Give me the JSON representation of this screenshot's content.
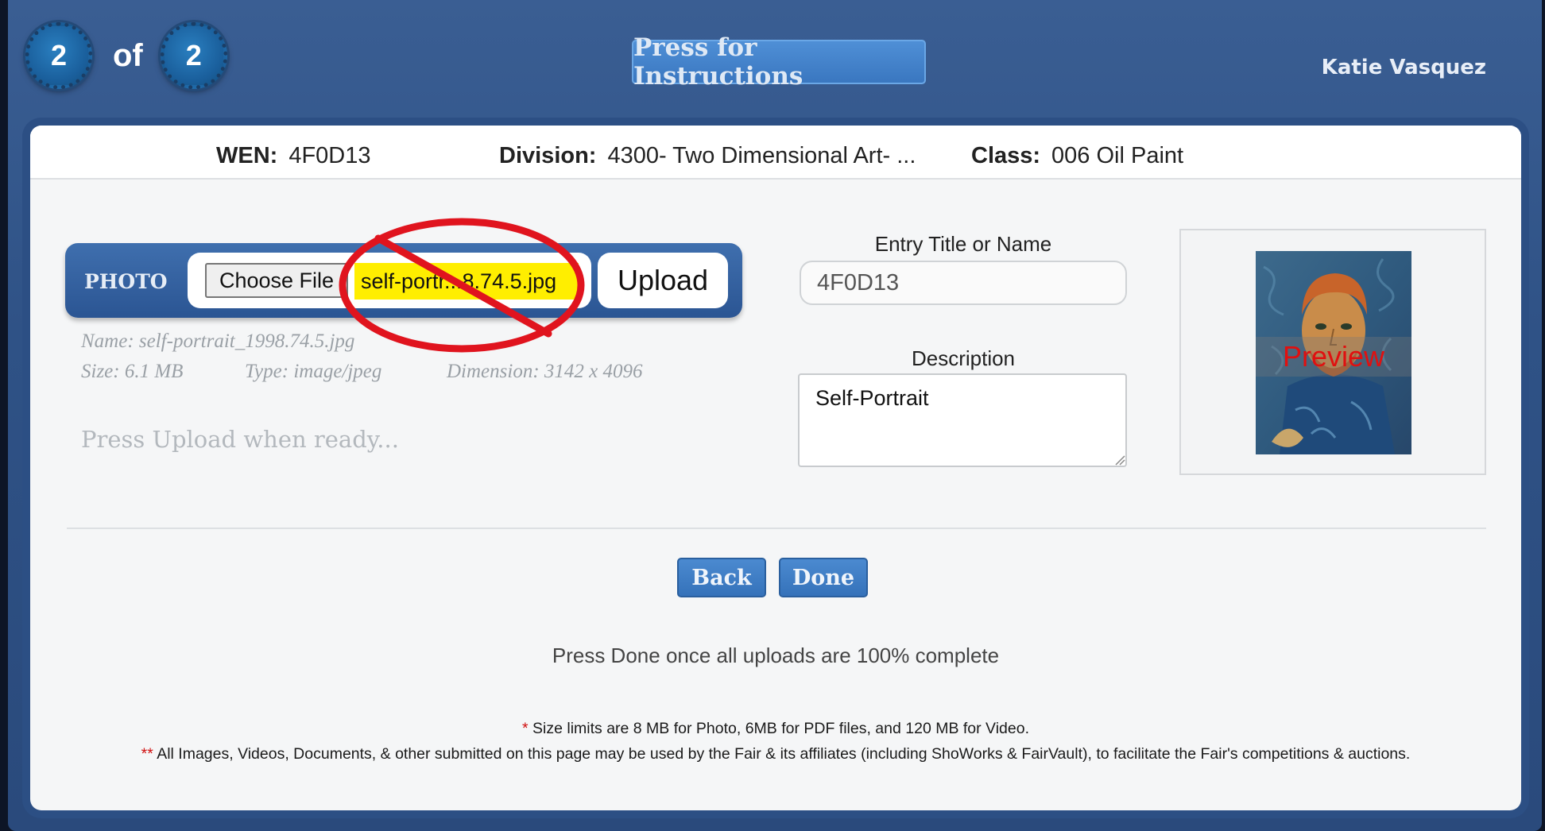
{
  "header": {
    "current_step": "2",
    "of_label": "of",
    "total_steps": "2",
    "instructions_label": "Press for Instructions",
    "user_name": "Katie Vasquez"
  },
  "info_bar": {
    "wen_label": "WEN:",
    "wen_value": "4F0D13",
    "division_label": "Division:",
    "division_value": "4300- Two Dimensional Art- ...",
    "class_label": "Class:",
    "class_value": "006 Oil Paint"
  },
  "upload": {
    "section_label": "PHOTO",
    "choose_file_label": "Choose File",
    "selected_filename": "self-portr...8.74.5.jpg",
    "upload_label": "Upload",
    "file_name": "Name: self-portrait_1998.74.5.jpg",
    "file_size": "Size: 6.1 MB",
    "file_type": "Type: image/jpeg",
    "file_dimension": "Dimension: 3142 x 4096",
    "status": "Press Upload when ready..."
  },
  "entry": {
    "title_label": "Entry Title or Name",
    "title_value": "4F0D13",
    "description_label": "Description",
    "description_value": "Self-Portrait"
  },
  "preview": {
    "overlay_text": "Preview"
  },
  "actions": {
    "back_label": "Back",
    "done_label": "Done",
    "done_message": "Press Done once all uploads are 100% complete"
  },
  "footnotes": {
    "size_marker": "*",
    "size_note": "Size limits are 8 MB for Photo, 6MB for PDF files, and 120 MB for Video.",
    "usage_marker": "**",
    "usage_note": "All Images, Videos, Documents, & other submitted on this page may be used by the Fair & its affiliates (including ShoWorks & FairVault), to facilitate the Fair's competitions & auctions."
  },
  "colors": {
    "header_bg": "#2f5286",
    "button_blue": "#3a77c0",
    "filename_highlight": "#ffee00",
    "no_sign_red": "#e0141e",
    "preview_red": "#e01010"
  },
  "icons": {
    "no_sign": "prohibited-circle-slash",
    "resize_grip": "textarea-resize-grip"
  }
}
